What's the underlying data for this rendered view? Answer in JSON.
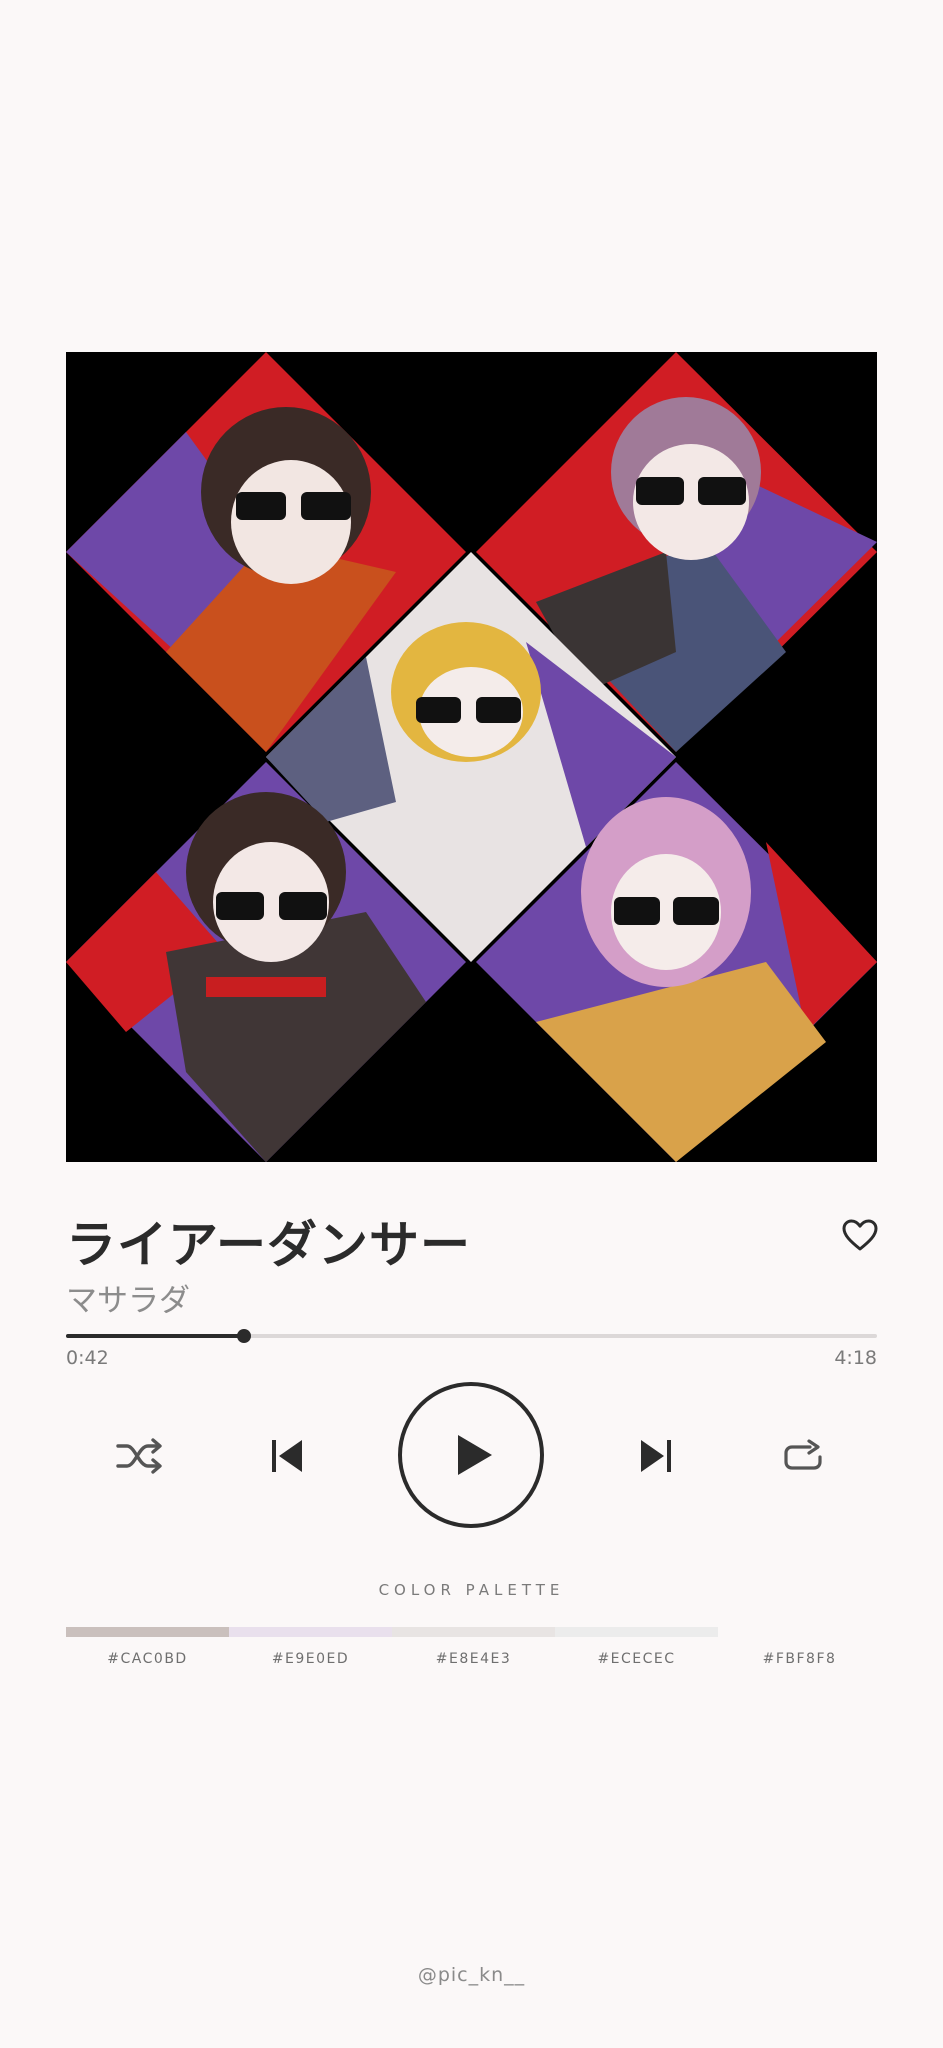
{
  "song": {
    "title": "ライアーダンサー",
    "artist": "マサラダ"
  },
  "playback": {
    "elapsed": "0:42",
    "total": "4:18",
    "progress_fraction": 0.22
  },
  "controls": {
    "shuffle_icon": "shuffle-icon",
    "prev_icon": "skip-previous-icon",
    "play_icon": "play-icon",
    "next_icon": "skip-next-icon",
    "repeat_icon": "repeat-icon",
    "favorite_icon": "heart-outline-icon"
  },
  "palette": {
    "title": "COLOR PALETTE",
    "colors": [
      {
        "hex": "#CAC0BD",
        "label": "#CAC0BD"
      },
      {
        "hex": "#E9E0ED",
        "label": "#E9E0ED"
      },
      {
        "hex": "#E8E4E3",
        "label": "#E8E4E3"
      },
      {
        "hex": "#ECECEC",
        "label": "#ECECEC"
      },
      {
        "hex": "#FBF8F8",
        "label": "#FBF8F8"
      }
    ]
  },
  "credit": "@pic_kn__",
  "colors": {
    "background": "#FBF8F8",
    "text_primary": "#2B2B2B",
    "text_secondary": "#8C8C8C",
    "artwork_red": "#D01D24",
    "artwork_purple": "#6E48A8"
  }
}
